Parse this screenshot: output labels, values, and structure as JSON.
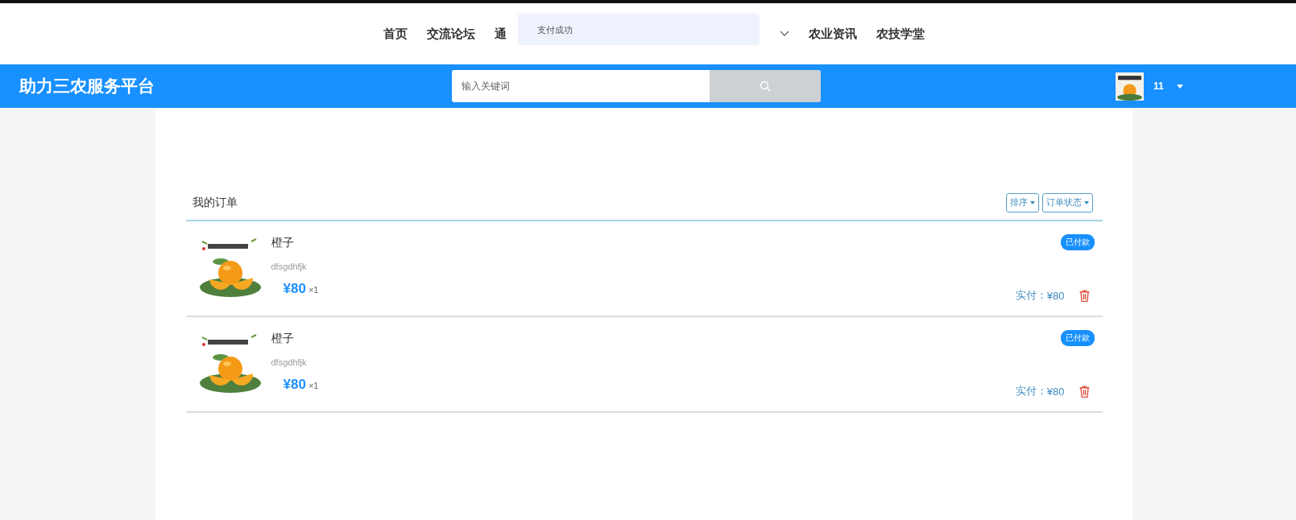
{
  "nav": {
    "items": [
      {
        "label": "首页"
      },
      {
        "label": "交流论坛"
      },
      {
        "label": "通"
      },
      {
        "label": "农业资讯"
      },
      {
        "label": "农技学堂"
      }
    ]
  },
  "toast": {
    "message": "支付成功"
  },
  "header": {
    "brand": "助力三农服务平台",
    "search": {
      "placeholder": "输入关键词"
    },
    "user": {
      "name": "11"
    }
  },
  "orders": {
    "title": "我的订单",
    "filters": [
      {
        "label": "排序"
      },
      {
        "label": "订单状态"
      }
    ],
    "rows": [
      {
        "name": "橙子",
        "description": "dfsgdhfjk",
        "price": "¥80",
        "quantity": "×1",
        "status": "已付款",
        "paid_label": "实付：",
        "paid": "¥80"
      },
      {
        "name": "橙子",
        "description": "dfsgdhfjk",
        "price": "¥80",
        "quantity": "×1",
        "status": "已付款",
        "paid_label": "实付：",
        "paid": "¥80"
      }
    ]
  }
}
